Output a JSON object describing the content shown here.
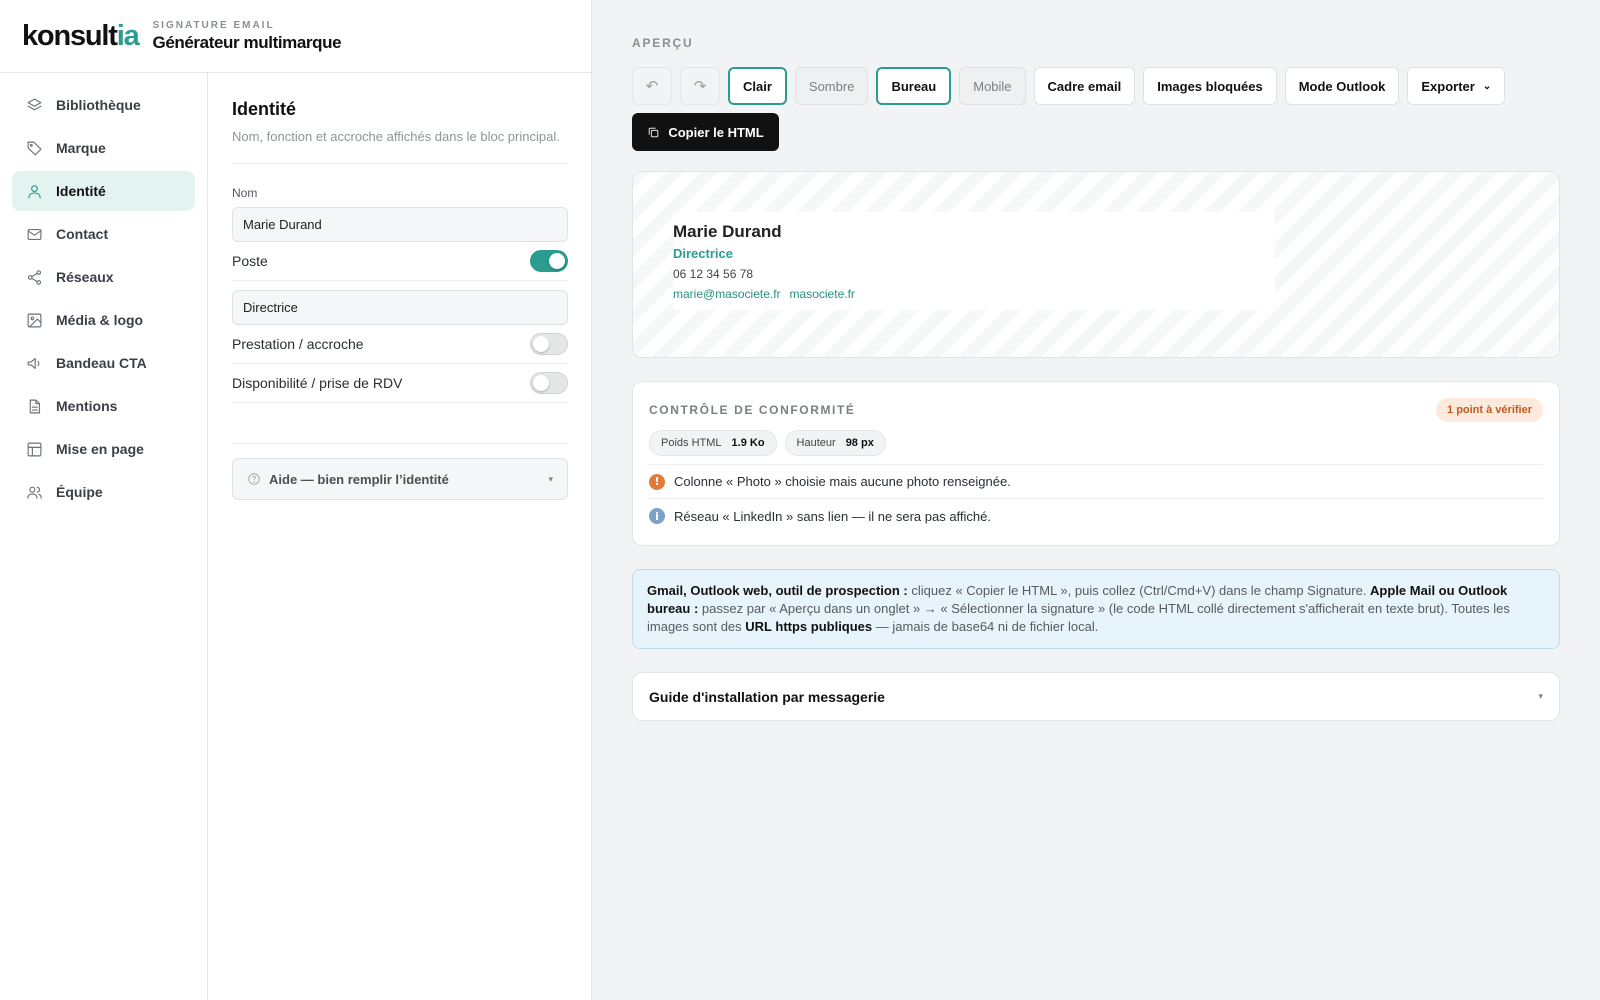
{
  "brand": {
    "logo_main": "konsult",
    "logo_accent": "ia",
    "eyebrow": "SIGNATURE EMAIL",
    "title": "Générateur multimarque"
  },
  "nav": {
    "items": [
      {
        "label": "Bibliothèque",
        "icon": "layers-icon"
      },
      {
        "label": "Marque",
        "icon": "tag-icon"
      },
      {
        "label": "Identité",
        "icon": "user-icon",
        "active": true
      },
      {
        "label": "Contact",
        "icon": "mail-icon"
      },
      {
        "label": "Réseaux",
        "icon": "share-icon"
      },
      {
        "label": "Média & logo",
        "icon": "image-icon"
      },
      {
        "label": "Bandeau CTA",
        "icon": "megaphone-icon"
      },
      {
        "label": "Mentions",
        "icon": "document-icon"
      },
      {
        "label": "Mise en page",
        "icon": "layout-icon"
      },
      {
        "label": "Équipe",
        "icon": "team-icon"
      }
    ]
  },
  "form": {
    "title": "Identité",
    "subtitle": "Nom, fonction et accroche affichés dans le bloc principal.",
    "name_label": "Nom",
    "name_value": "Marie Durand",
    "poste_label": "Poste",
    "poste_on": true,
    "poste_value": "Directrice",
    "prestation_label": "Prestation / accroche",
    "prestation_on": false,
    "dispo_label": "Disponibilité / prise de RDV",
    "dispo_on": false,
    "help_label": "Aide — bien remplir l’identité",
    "caret": "▾"
  },
  "preview": {
    "eyebrow": "APERÇU",
    "undo_icon": "undo-icon",
    "redo_icon": "redo-icon",
    "buttons": {
      "clair": "Clair",
      "sombre": "Sombre",
      "bureau": "Bureau",
      "mobile": "Mobile",
      "cadre": "Cadre email",
      "images": "Images bloquées",
      "outlook": "Mode Outlook",
      "exporter": "Exporter"
    },
    "copy_label": "Copier le HTML",
    "signature": {
      "name": "Marie Durand",
      "role": "Directrice",
      "phone": "06 12 34 56 78",
      "email": "marie@masociete.fr",
      "website": "masociete.fr"
    }
  },
  "compliance": {
    "title": "CONTRÔLE DE CONFORMITÉ",
    "badge": "1 point à vérifier",
    "chips": [
      {
        "label": "Poids HTML",
        "value": "1.9 Ko"
      },
      {
        "label": "Hauteur",
        "value": "98 px"
      }
    ],
    "issues": [
      {
        "type": "warn",
        "symbol": "!",
        "text": "Colonne « Photo » choisie mais aucune photo renseignée."
      },
      {
        "type": "info",
        "symbol": "i",
        "text": "Réseau « LinkedIn » sans lien — il ne sera pas affiché."
      }
    ]
  },
  "note": {
    "b1": "Gmail, Outlook web, outil de prospection :",
    "t1": " cliquez « Copier le HTML », puis collez (Ctrl/Cmd+V) dans le champ Signature. ",
    "b2": "Apple Mail ou Outlook bureau :",
    "t2": " passez par « Aperçu dans un onglet » → « Sélectionner la signature » (le code HTML collé directement s'afficherait en texte brut). Toutes les images sont des ",
    "b3": "URL https publiques",
    "t3": " — jamais de base64 ni de fichier local."
  },
  "guide": {
    "title": "Guide d'installation par messagerie",
    "caret": "▾"
  },
  "colors": {
    "accent": "#2a9d8f",
    "warn": "#e07b3b",
    "info": "#7ea1c8"
  }
}
